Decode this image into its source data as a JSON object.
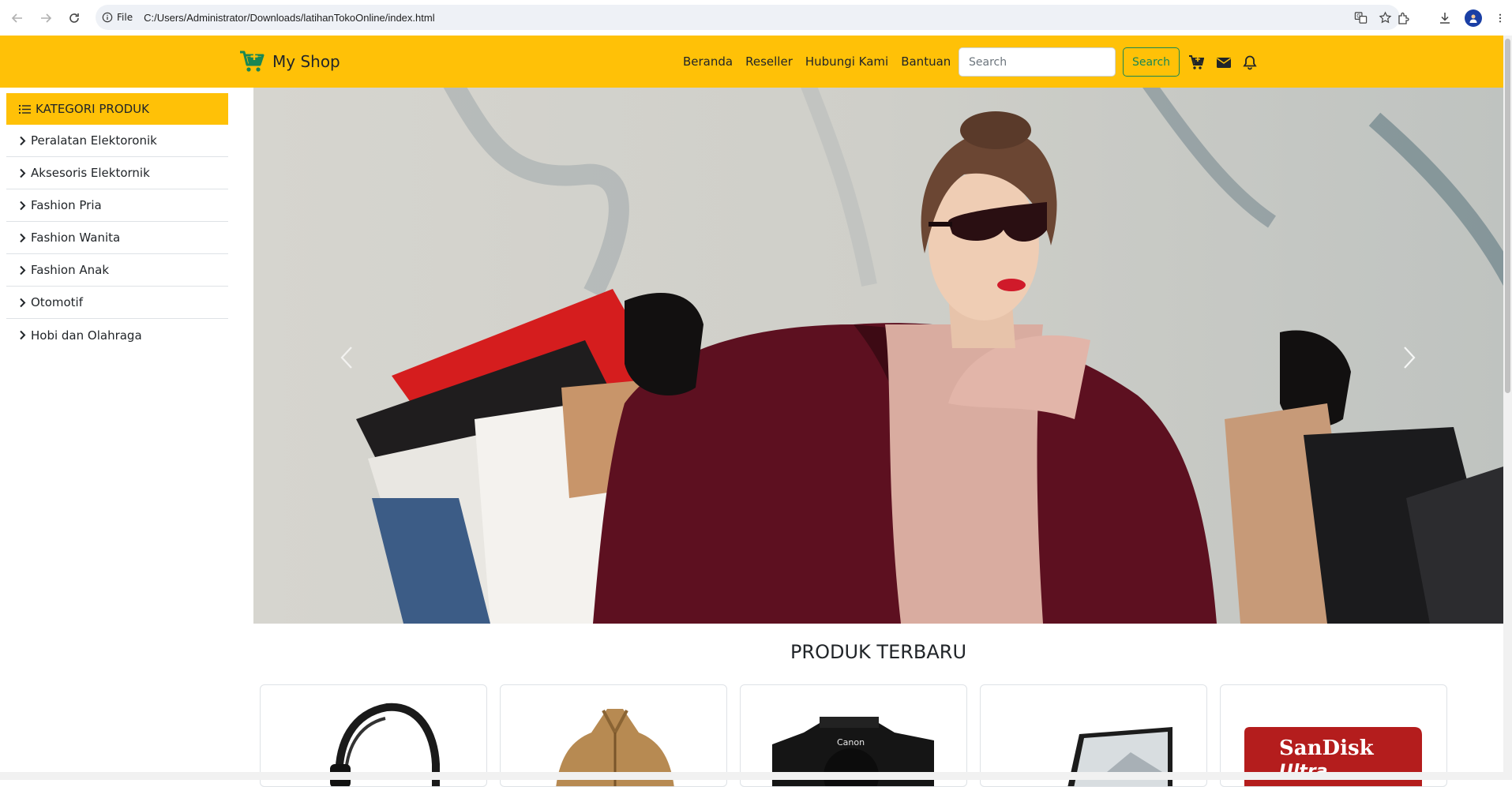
{
  "browser": {
    "site_info_label": "File",
    "url": "C:/Users/Administrator/Downloads/latihanTokoOnline/index.html",
    "icons": [
      "back-icon",
      "forward-icon",
      "reload-icon",
      "info-icon",
      "translate-icon",
      "bookmark-star-icon",
      "extensions-icon",
      "download-icon",
      "profile-icon",
      "menu-dots-icon"
    ]
  },
  "navbar": {
    "brand": "My Shop",
    "menu": [
      "Beranda",
      "Reseller",
      "Hubungi Kami",
      "Bantuan"
    ],
    "search_placeholder": "Search",
    "search_button": "Search",
    "icons": [
      "cart-plus-icon",
      "envelope-icon",
      "bell-icon"
    ],
    "colors": {
      "background": "#ffc107",
      "search_button": "#198754"
    }
  },
  "sidebar": {
    "title": "KATEGORI PRODUK",
    "items": [
      {
        "label": "Peralatan Elektoronik"
      },
      {
        "label": "Aksesoris Elektornik"
      },
      {
        "label": "Fashion Pria"
      },
      {
        "label": "Fashion Wanita"
      },
      {
        "label": "Fashion Anak"
      },
      {
        "label": "Otomotif"
      },
      {
        "label": "Hobi dan Olahraga"
      }
    ]
  },
  "carousel": {
    "controls": [
      "carousel-prev-icon",
      "carousel-next-icon"
    ]
  },
  "products": {
    "title": "PRODUK TERBARU",
    "cards": [
      {
        "image": "headphones"
      },
      {
        "image": "jacket"
      },
      {
        "image": "camera",
        "brand_label": "Canon"
      },
      {
        "image": "laptop"
      },
      {
        "image": "memory-card",
        "brand_label": "SanDisk",
        "sub_label": "Ultra"
      }
    ]
  }
}
